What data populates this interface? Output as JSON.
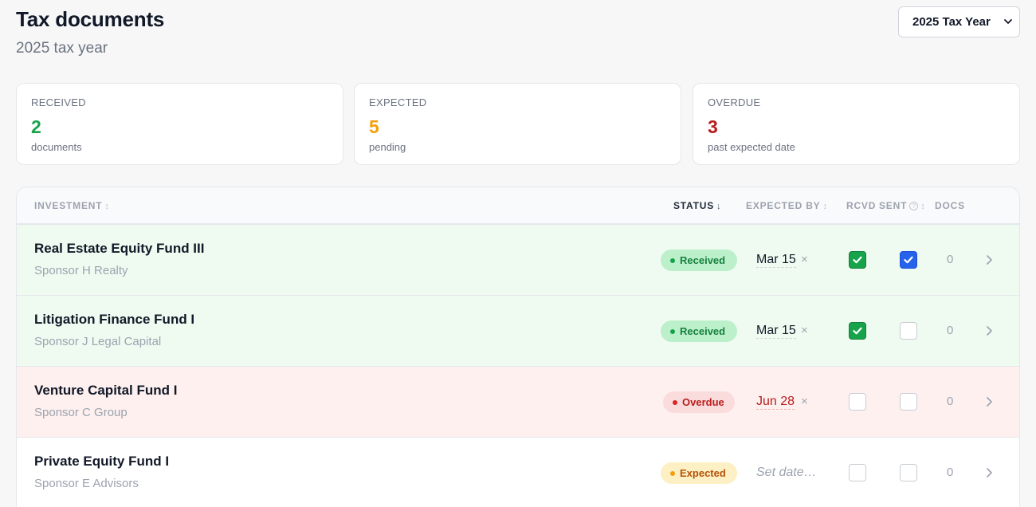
{
  "header": {
    "title": "Tax documents",
    "subtitle": "2025 tax year",
    "year_select": "2025 Tax Year"
  },
  "summary": [
    {
      "label": "RECEIVED",
      "value": "2",
      "sub": "documents",
      "color": "#16a34a"
    },
    {
      "label": "EXPECTED",
      "value": "5",
      "sub": "pending",
      "color": "#f59e0b"
    },
    {
      "label": "OVERDUE",
      "value": "3",
      "sub": "past expected date",
      "color": "#b91c1c"
    }
  ],
  "table": {
    "columns": {
      "investment": "INVESTMENT",
      "status": "STATUS",
      "expected_by": "EXPECTED BY",
      "rcvd": "RCVD",
      "sent": "SENT",
      "docs": "DOCS"
    },
    "sort_indicator": "↕",
    "active_sort_indicator": "↓",
    "help_glyph": "?",
    "clear_glyph": "×",
    "rows": [
      {
        "name": "Real Estate Equity Fund III",
        "sponsor": "Sponsor H Realty",
        "status": "Received",
        "expected_by": "Mar 15",
        "rcvd": true,
        "sent": true,
        "docs": "0"
      },
      {
        "name": "Litigation Finance Fund I",
        "sponsor": "Sponsor J Legal Capital",
        "status": "Received",
        "expected_by": "Mar 15",
        "rcvd": true,
        "sent": false,
        "docs": "0"
      },
      {
        "name": "Venture Capital Fund I",
        "sponsor": "Sponsor C Group",
        "status": "Overdue",
        "expected_by": "Jun 28",
        "rcvd": false,
        "sent": false,
        "docs": "0"
      },
      {
        "name": "Private Equity Fund I",
        "sponsor": "Sponsor E Advisors",
        "status": "Expected",
        "expected_by_placeholder": "Set date…",
        "rcvd": false,
        "sent": false,
        "docs": "0"
      }
    ]
  }
}
